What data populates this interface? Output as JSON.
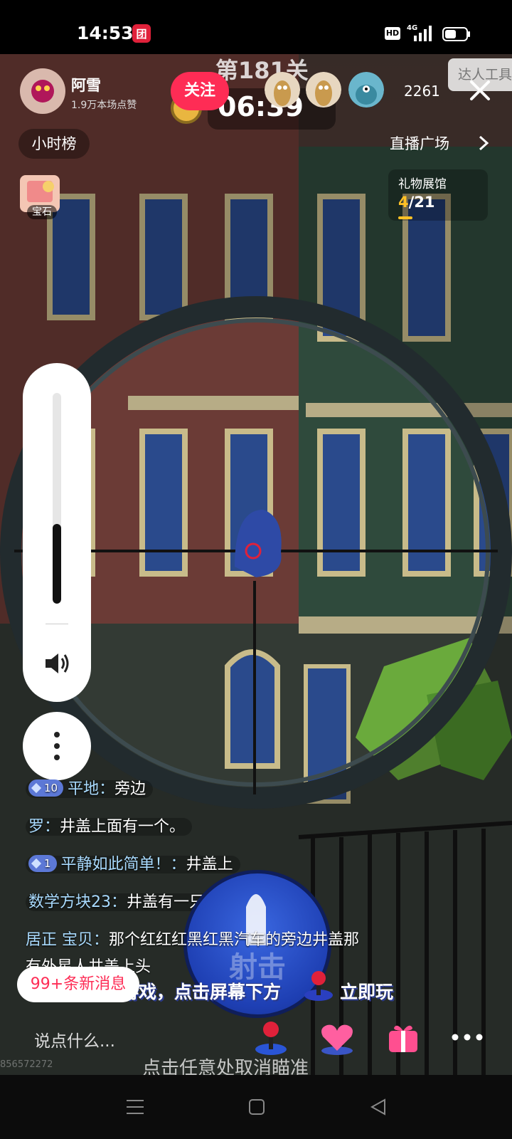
{
  "status_bar": {
    "time": "14:53",
    "notification_badge": "团",
    "hd_label": "HD",
    "network_label": "4G"
  },
  "game": {
    "level_title": "第181关",
    "timer": "06:39",
    "hint_bottom": "点击任意处取消瞄准",
    "shoot_label": "射击",
    "promo_text": "主播同款游戏，点击屏幕下方",
    "promo_play": "立即玩"
  },
  "host": {
    "name": "阿雪",
    "likes": "1.9万本场点赞",
    "follow_label": "关注"
  },
  "viewers": {
    "count": "2261",
    "tool_label": "达人工具"
  },
  "nav": {
    "hour_rank": "小时榜",
    "plaza": "直播广场"
  },
  "gem": {
    "label": "宝石"
  },
  "gift_hall": {
    "label": "礼物展馆",
    "current": "4",
    "total": "/21"
  },
  "volume": {
    "level": 0.38
  },
  "chat": [
    {
      "badge": "10",
      "user": "平地：",
      "text": "旁边"
    },
    {
      "badge": "",
      "user": "罗：",
      "text": "井盖上面有一个。"
    },
    {
      "badge": "1",
      "user": "平静如此简单！：",
      "text": "井盖上"
    },
    {
      "badge": "",
      "user": "数学方块23：",
      "text": "井盖有一只"
    },
    {
      "badge": "",
      "user": "居正 宝贝：",
      "text": "那个红红红黑红黑汽车的旁边井盖那",
      "text2": "有外星人井盖上头"
    }
  ],
  "new_messages": "99+条新消息",
  "comment_placeholder": "说点什么...",
  "watermark": "856572272",
  "colors": {
    "accent_pink": "#fe2c55",
    "username_blue": "#a9dbff",
    "gold": "#ffc125"
  }
}
